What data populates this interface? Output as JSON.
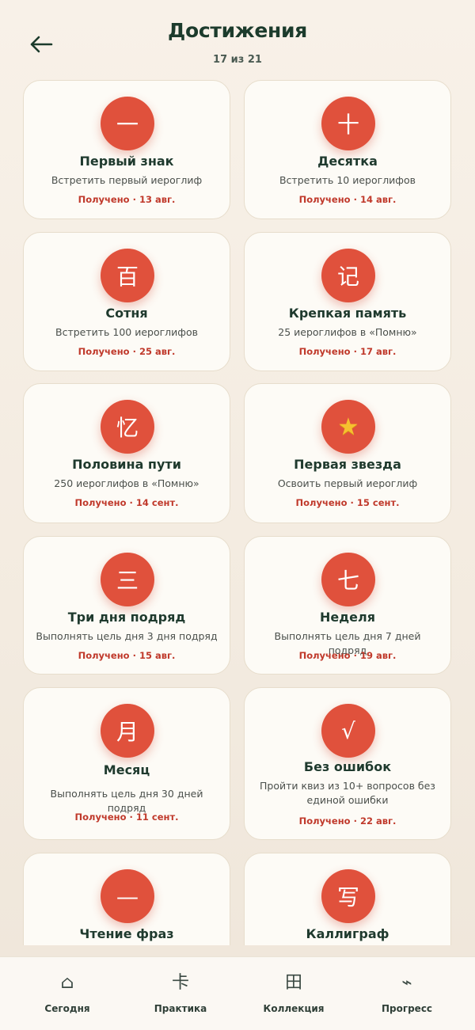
{
  "header": {
    "title": "Достижения",
    "subtitle": "17 из 21",
    "back_icon": "arrow-left-icon"
  },
  "achievements": [
    {
      "glyph": "一",
      "title": "Первый знак",
      "desc": "Встретить первый иероглиф",
      "date": "Получено · 13 авг."
    },
    {
      "glyph": "十",
      "title": "Десятка",
      "desc": "Встретить 10 иероглифов",
      "date": "Получено · 14 авг."
    },
    {
      "glyph": "百",
      "title": "Сотня",
      "desc": "Встретить 100 иероглифов",
      "date": "Получено · 25 авг."
    },
    {
      "glyph": "记",
      "title": "Крепкая память",
      "desc": "25 иероглифов в «Помню»",
      "date": "Получено · 17 авг."
    },
    {
      "glyph": "忆",
      "title": "Половина пути",
      "desc": "250 иероглифов в «Помню»",
      "date": "Получено · 14 сент."
    },
    {
      "glyph": "★",
      "title": "Первая звезда",
      "desc": "Освоить первый иероглиф",
      "date": "Получено · 15 сент."
    },
    {
      "glyph": "三",
      "title": "Три дня подряд",
      "desc": "Выполнять цель дня 3 дня подряд",
      "date": "Получено · 15 авг."
    },
    {
      "glyph": "七",
      "title": "Неделя",
      "desc": "Выполнять цель дня 7 дней подряд",
      "date": "Получено · 19 авг."
    },
    {
      "glyph": "月",
      "title": "Месяц",
      "desc": "Выполнять цель дня 30 дней подряд",
      "date": "Получено · 11 сент."
    },
    {
      "glyph": "√",
      "title": "Без ошибок",
      "desc": "Пройти квиз из 10+ вопросов без единой ошибки",
      "date": "Получено · 22 авг."
    },
    {
      "glyph": "—",
      "title": "Чтение фраз",
      "desc": "",
      "date": ""
    },
    {
      "glyph": "写",
      "title": "Каллиграф",
      "desc": "",
      "date": ""
    }
  ],
  "nav": [
    {
      "label": "Сегодня",
      "icon": "⌂",
      "icon_name": "home-icon"
    },
    {
      "label": "Практика",
      "icon": "卡",
      "icon_name": "practice-icon"
    },
    {
      "label": "Коллекция",
      "icon": "田",
      "icon_name": "collection-icon"
    },
    {
      "label": "Прогресс",
      "icon": "⌁",
      "icon_name": "progress-icon"
    }
  ],
  "colors": {
    "accent": "#e0513c",
    "date_text": "#c0392b",
    "title_text": "#1c3b2c",
    "card_bg": "#fdfbf6"
  }
}
